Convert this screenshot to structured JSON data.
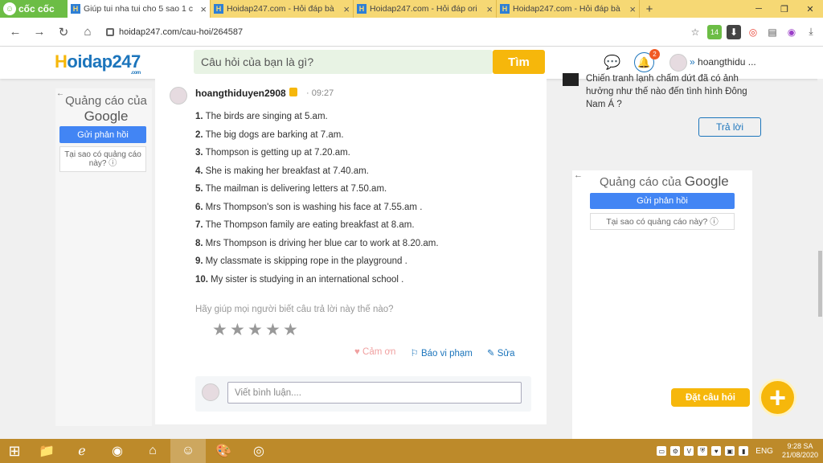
{
  "browser": {
    "brand": "cốc cốc",
    "tabs": [
      {
        "title": "Giúp tui nha tui cho 5 sao 1 c",
        "active": true
      },
      {
        "title": "Hoidap247.com - Hỏi đáp bà",
        "active": false
      },
      {
        "title": "Hoidap247.com - Hỏi đáp ori",
        "active": false
      },
      {
        "title": "Hoidap247.com - Hỏi đáp bà",
        "active": false
      }
    ],
    "url": "hoidap247.com/cau-hoi/264587",
    "ext_badge": "14"
  },
  "header": {
    "logo_h": "H",
    "logo_rest": "oidap247",
    "logo_small": ".com",
    "search_placeholder": "Câu hỏi của bạn là gì?",
    "search_button": "Tìm",
    "notif_count": "2",
    "username": "hoangthidu ..."
  },
  "ad_left": {
    "title_line1": "Quảng cáo của",
    "title_line2": "Google",
    "feedback": "Gửi phản hồi",
    "why": "Tại sao có quảng cáo này? ⓘ"
  },
  "answer": {
    "username": "hoangthiduyen2908",
    "time": "· 09:27",
    "items": [
      {
        "n": "1.",
        "text": "The birds are singing at 5.am."
      },
      {
        "n": "2.",
        "text": "The big dogs are barking at 7.am."
      },
      {
        "n": "3.",
        "text": "Thompson is getting up at 7.20.am."
      },
      {
        "n": "4.",
        "text": "She is making her breakfast at 7.40.am."
      },
      {
        "n": "5.",
        "text": "The mailman is delivering letters at 7.50.am."
      },
      {
        "n": "6.",
        "text": "Mrs Thompson's son is washing his face at 7.55.am ."
      },
      {
        "n": "7.",
        "text": "The Thompson family are eating breakfast at 8.am."
      },
      {
        "n": "8.",
        "text": "Mrs Thompson is driving her blue car to work at 8.20.am."
      },
      {
        "n": "9.",
        "text": "My classmate is skipping rope in the playground ."
      },
      {
        "n": "10.",
        "text": "My sister is studying in an international school ."
      }
    ],
    "help_text": "Hãy giúp mọi người biết câu trả lời này thế nào?",
    "rating": {
      "value": 0,
      "max": 5
    },
    "thanks": "♥ Cảm ơn",
    "report": "⚐ Báo vi phạm",
    "edit": "✎ Sửa",
    "comment_placeholder": "Viết bình luận...."
  },
  "right_panel": {
    "question_text": "Chiến tranh lạnh chấm dứt đã có ảnh hưởng như thế nào đến tình hình Đông Nam Á ?",
    "reply": "Trả lời",
    "ad_title": "Quảng cáo của",
    "ad_google": "Google",
    "ad_feedback": "Gửi phản hồi",
    "ad_why": "Tại sao có quảng cáo này? ⓘ"
  },
  "ask": {
    "label": "Đặt câu hỏi",
    "button": "+"
  },
  "taskbar": {
    "lang": "ENG",
    "time": "9:28 SA",
    "date": "21/08/2020"
  }
}
